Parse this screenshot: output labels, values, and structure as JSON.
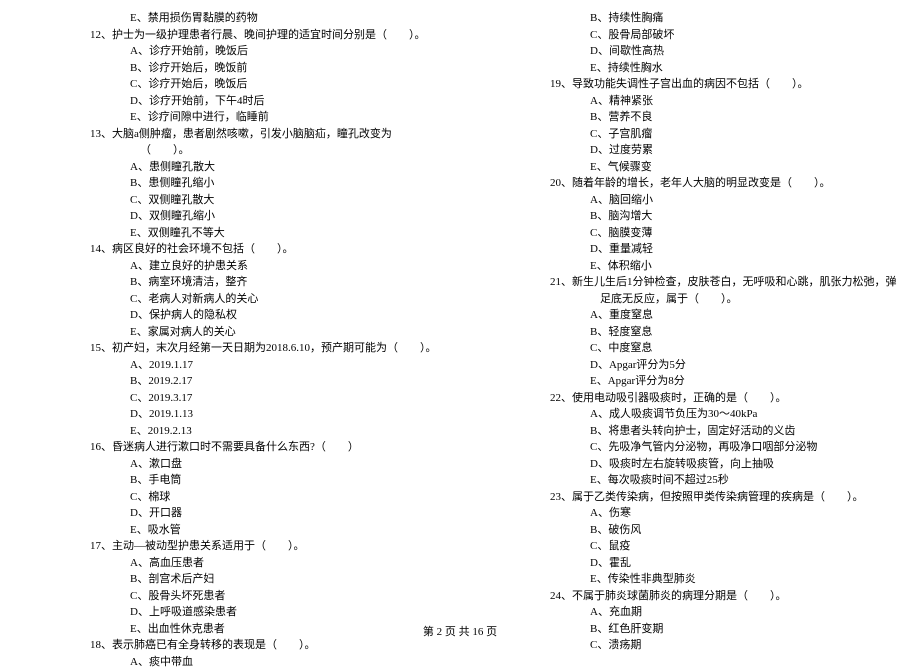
{
  "left_column": {
    "items": [
      {
        "type": "opt",
        "text": "E、禁用损伤胃黏膜的药物"
      },
      {
        "type": "q",
        "text": "12、护士为一级护理患者行晨、晚间护理的适宜时间分别是（　　）。"
      },
      {
        "type": "opt",
        "text": "A、诊疗开始前，晚饭后"
      },
      {
        "type": "opt",
        "text": "B、诊疗开始后，晚饭前"
      },
      {
        "type": "opt",
        "text": "C、诊疗开始后，晚饭后"
      },
      {
        "type": "opt",
        "text": "D、诊疗开始前，下午4时后"
      },
      {
        "type": "opt",
        "text": "E、诊疗间隙中进行，临睡前"
      },
      {
        "type": "q",
        "text": "13、大脑a侧肿瘤，患者剧然咳嗽，引发小脑脑疝，瞳孔改变为（　　）。"
      },
      {
        "type": "opt",
        "text": "A、患侧瞳孔散大"
      },
      {
        "type": "opt",
        "text": "B、患侧瞳孔缩小"
      },
      {
        "type": "opt",
        "text": "C、双侧瞳孔散大"
      },
      {
        "type": "opt",
        "text": "D、双侧瞳孔缩小"
      },
      {
        "type": "opt",
        "text": "E、双侧瞳孔不等大"
      },
      {
        "type": "q",
        "text": "14、病区良好的社会环境不包括（　　）。"
      },
      {
        "type": "opt",
        "text": "A、建立良好的护患关系"
      },
      {
        "type": "opt",
        "text": "B、病室环境清洁，整齐"
      },
      {
        "type": "opt",
        "text": "C、老病人对新病人的关心"
      },
      {
        "type": "opt",
        "text": "D、保护病人的隐私权"
      },
      {
        "type": "opt",
        "text": "E、家属对病人的关心"
      },
      {
        "type": "q",
        "text": "15、初产妇，末次月经第一天日期为2018.6.10，预产期可能为（　　）。"
      },
      {
        "type": "opt",
        "text": "A、2019.1.17"
      },
      {
        "type": "opt",
        "text": "B、2019.2.17"
      },
      {
        "type": "opt",
        "text": "C、2019.3.17"
      },
      {
        "type": "opt",
        "text": "D、2019.1.13"
      },
      {
        "type": "opt",
        "text": "E、2019.2.13"
      },
      {
        "type": "q",
        "text": "16、昏迷病人进行漱口时不需要具备什么东西?（　　）"
      },
      {
        "type": "opt",
        "text": "A、漱口盘"
      },
      {
        "type": "opt",
        "text": "B、手电筒"
      },
      {
        "type": "opt",
        "text": "C、棉球"
      },
      {
        "type": "opt",
        "text": "D、开口器"
      },
      {
        "type": "opt",
        "text": "E、吸水管"
      },
      {
        "type": "q",
        "text": "17、主动—被动型护患关系适用于（　　）。"
      },
      {
        "type": "opt",
        "text": "A、高血压患者"
      },
      {
        "type": "opt",
        "text": "B、剖宫术后产妇"
      },
      {
        "type": "opt",
        "text": "C、股骨头坏死患者"
      },
      {
        "type": "opt",
        "text": "D、上呼吸道感染患者"
      },
      {
        "type": "opt",
        "text": "E、出血性休克患者"
      },
      {
        "type": "q",
        "text": "18、表示肺癌已有全身转移的表现是（　　）。"
      },
      {
        "type": "opt",
        "text": "A、痰中带血"
      }
    ]
  },
  "right_column": {
    "items": [
      {
        "type": "opt",
        "text": "B、持续性胸痛"
      },
      {
        "type": "opt",
        "text": "C、股骨局部破坏"
      },
      {
        "type": "opt",
        "text": "D、间歇性高热"
      },
      {
        "type": "opt",
        "text": "E、持续性胸水"
      },
      {
        "type": "q",
        "text": "19、导致功能失调性子宫出血的病因不包括（　　）。"
      },
      {
        "type": "opt",
        "text": "A、精神紧张"
      },
      {
        "type": "opt",
        "text": "B、营养不良"
      },
      {
        "type": "opt",
        "text": "C、子宫肌瘤"
      },
      {
        "type": "opt",
        "text": "D、过度劳累"
      },
      {
        "type": "opt",
        "text": "E、气候骤变"
      },
      {
        "type": "q",
        "text": "20、随着年龄的增长，老年人大脑的明显改变是（　　）。"
      },
      {
        "type": "opt",
        "text": "A、脑回缩小"
      },
      {
        "type": "opt",
        "text": "B、脑沟增大"
      },
      {
        "type": "opt",
        "text": "C、脑膜变薄"
      },
      {
        "type": "opt",
        "text": "D、重量减轻"
      },
      {
        "type": "opt",
        "text": "E、体积缩小"
      },
      {
        "type": "q",
        "text": "21、新生儿生后1分钟检查，皮肤苍白，无呼吸和心跳，肌张力松弛，弹足底无反应，属于（　　）。"
      },
      {
        "type": "opt",
        "text": "A、重度窒息"
      },
      {
        "type": "opt",
        "text": "B、轻度窒息"
      },
      {
        "type": "opt",
        "text": "C、中度窒息"
      },
      {
        "type": "opt",
        "text": "D、Apgar评分为5分"
      },
      {
        "type": "opt",
        "text": "E、Apgar评分为8分"
      },
      {
        "type": "q",
        "text": "22、使用电动吸引器吸痰时，正确的是（　　）。"
      },
      {
        "type": "opt",
        "text": "A、成人吸痰调节负压为30～40kPa"
      },
      {
        "type": "opt",
        "text": "B、将患者头转向护士，固定好活动的义齿"
      },
      {
        "type": "opt",
        "text": "C、先吸净气管内分泌物，再吸净口咽部分泌物"
      },
      {
        "type": "opt",
        "text": "D、吸痰时左右旋转吸痰管，向上抽吸"
      },
      {
        "type": "opt",
        "text": "E、每次吸痰时间不超过25秒"
      },
      {
        "type": "q",
        "text": "23、属于乙类传染病，但按照甲类传染病管理的疾病是（　　）。"
      },
      {
        "type": "opt",
        "text": "A、伤寒"
      },
      {
        "type": "opt",
        "text": "B、破伤风"
      },
      {
        "type": "opt",
        "text": "C、鼠疫"
      },
      {
        "type": "opt",
        "text": "D、霍乱"
      },
      {
        "type": "opt",
        "text": "E、传染性非典型肺炎"
      },
      {
        "type": "q",
        "text": "24、不属于肺炎球菌肺炎的病理分期是（　　）。"
      },
      {
        "type": "opt",
        "text": "A、充血期"
      },
      {
        "type": "opt",
        "text": "B、红色肝变期"
      },
      {
        "type": "opt",
        "text": "C、溃疡期"
      }
    ]
  },
  "footer": "第 2 页 共 16 页"
}
